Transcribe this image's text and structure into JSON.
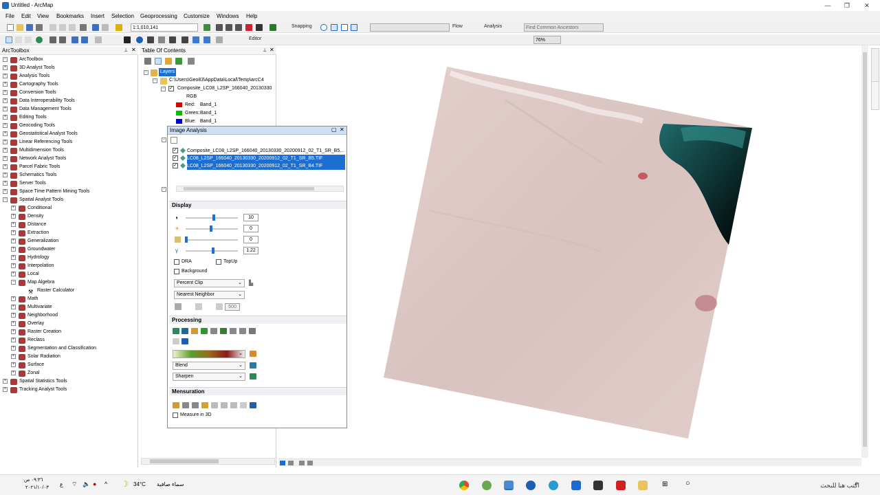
{
  "window": {
    "title": "Untitled - ArcMap",
    "controls": {
      "minimize": "—",
      "restore": "❐",
      "close": "✕"
    }
  },
  "menu": [
    "File",
    "Edit",
    "View",
    "Bookmarks",
    "Insert",
    "Selection",
    "Geoprocessing",
    "Customize",
    "Windows",
    "Help"
  ],
  "toolbar": {
    "scale": "1:1,010,141",
    "snapping_label": "Snapping",
    "flow_label": "Flow",
    "analysis_label": "Analysis",
    "find_ancestors_placeholder": "Find Common Ancestors",
    "editor_label": "Editor",
    "zoom_percent": "76%"
  },
  "arctoolbox": {
    "title": "ArcToolbox",
    "root": "ArcToolbox",
    "items": [
      "3D Analyst Tools",
      "Analysis Tools",
      "Cartography Tools",
      "Conversion Tools",
      "Data Interoperability Tools",
      "Data Management Tools",
      "Editing Tools",
      "Geocoding Tools",
      "Geostatistical Analyst Tools",
      "Linear Referencing Tools",
      "Multidimension Tools",
      "Network Analyst Tools",
      "Parcel Fabric Tools",
      "Schematics Tools",
      "Server Tools",
      "Space Time Pattern Mining Tools",
      "Spatial Analyst Tools"
    ],
    "spatial_analyst_children": [
      "Conditional",
      "Density",
      "Distance",
      "Extraction",
      "Generalization",
      "Groundwater",
      "Hydrology",
      "Interpolation",
      "Local",
      "Map Algebra"
    ],
    "map_algebra_children": [
      "Raster Calculator"
    ],
    "spatial_analyst_children_2": [
      "Math",
      "Multivariate",
      "Neighborhood",
      "Overlay",
      "Raster Creation",
      "Reclass",
      "Segmentation and Classification",
      "Solar Radiation",
      "Surface",
      "Zonal"
    ],
    "bottom_items": [
      "Spatial Statistics Tools",
      "Tracking Analyst Tools"
    ]
  },
  "toc": {
    "title": "Table Of Contents",
    "layers_label": "Layers",
    "folder": "C:\\Users\\Geo83\\AppData\\Local\\Temp\\arcC4",
    "layer_name": "Composite_LC08_L2SP_166040_20130330",
    "rgb_label": "RGB",
    "bands": [
      {
        "label": "Red:",
        "value": "Band_1",
        "color": "#e00000"
      },
      {
        "label": "Green:",
        "value": "Band_1",
        "color": "#00c000"
      },
      {
        "label": "Blue:",
        "value": "Band_1",
        "color": "#0000d0"
      }
    ]
  },
  "image_analysis": {
    "title": "Image Analysis",
    "layers": [
      {
        "name": "Composite_LC08_L2SP_166040_20130330_20200912_02_T1_SR_B5...",
        "selected": false
      },
      {
        "name": "LC08_L2SP_166040_20130330_20200912_02_T1_SR_B5.TIF",
        "selected": true
      },
      {
        "name": "LC08_L2SP_166040_20130330_20200912_02_T1_SR_B4.TIF",
        "selected": true
      }
    ],
    "display": {
      "heading": "Display",
      "contrast": "10",
      "brightness": "0",
      "transparency": "0",
      "gamma": "1.22",
      "dra_label": "DRA",
      "topup_label": "TopUp",
      "background_label": "Background",
      "stretch": "Percent Clip",
      "resampling": "Nearest Neighbor",
      "refresh_value": "500"
    },
    "processing": {
      "heading": "Processing",
      "blend": "Blend",
      "sharpen": "Sharpen"
    },
    "mensuration": {
      "heading": "Mensuration",
      "measure3d_label": "Measure in 3D"
    }
  },
  "taskbar": {
    "search_placeholder": "اكتب هنا للبحث",
    "weather_temp": "34°C",
    "weather_text": "سماء صافية",
    "time": "٠٩:٣٦ ص",
    "date": "٢٠٢١/١٠/٠٣",
    "lang": "ع"
  }
}
